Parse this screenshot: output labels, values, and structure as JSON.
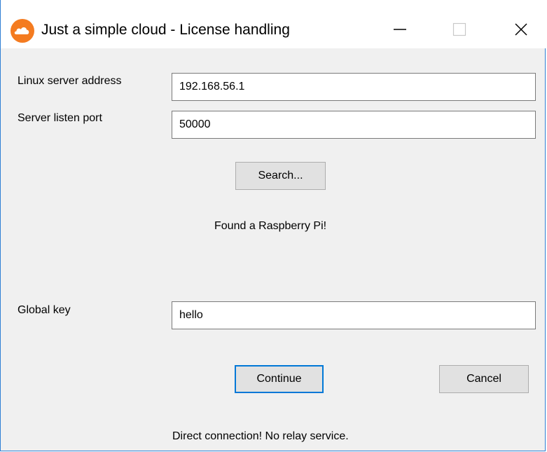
{
  "window": {
    "title": "Just a simple cloud - License handling",
    "accent_color": "#f47b20"
  },
  "form": {
    "server_address": {
      "label": "Linux server address",
      "value": "192.168.56.1"
    },
    "listen_port": {
      "label": "Server listen port",
      "value": "50000"
    },
    "search_button": "Search...",
    "search_status": "Found a Raspberry Pi!",
    "global_key": {
      "label": "Global key",
      "value": "hello"
    },
    "continue_button": "Continue",
    "cancel_button": "Cancel",
    "connection_status": "Direct connection! No relay service."
  }
}
